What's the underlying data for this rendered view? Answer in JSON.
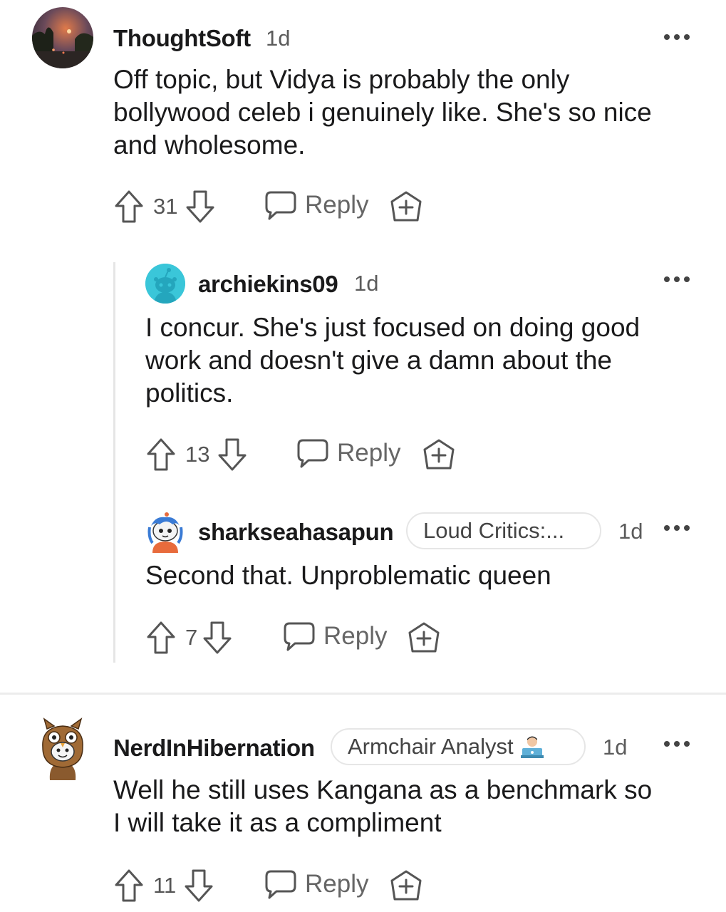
{
  "comments": [
    {
      "username": "ThoughtSoft",
      "time": "1d",
      "body_lines": [
        "Off topic, but Vidya is probably the only",
        "bollywood celeb i genuinely like. She's so nice",
        "and wholesome."
      ],
      "votes": "31",
      "reply_label": "Reply",
      "avatar_icon": "sunset-photo-avatar"
    },
    {
      "username": "archiekins09",
      "time": "1d",
      "body_lines": [
        "I concur. She's just focused on doing good",
        "work and doesn't give a damn about the",
        "politics."
      ],
      "votes": "13",
      "reply_label": "Reply",
      "avatar_icon": "snoo-avatar"
    },
    {
      "username": "sharkseahasapun",
      "flair": "Loud Critics:...",
      "time": "1d",
      "body_lines": [
        "Second that. Unproblematic queen"
      ],
      "votes": "7",
      "reply_label": "Reply",
      "avatar_icon": "snoo-custom-avatar"
    },
    {
      "username": "NerdInHibernation",
      "flair": "Armchair Analyst",
      "flair_icon": "laptop-person-emoji",
      "time": "1d",
      "body_lines": [
        "Well he still uses Kangana as a benchmark so",
        "I will take it as a compliment"
      ],
      "votes": "11",
      "reply_label": "Reply",
      "avatar_icon": "owl-hood-avatar"
    }
  ],
  "colors": {
    "text": "#1a1a1b",
    "muted": "#5b5b5b",
    "snoo_bg": "#3ac6d9",
    "thread_line": "#e5e5e5"
  }
}
